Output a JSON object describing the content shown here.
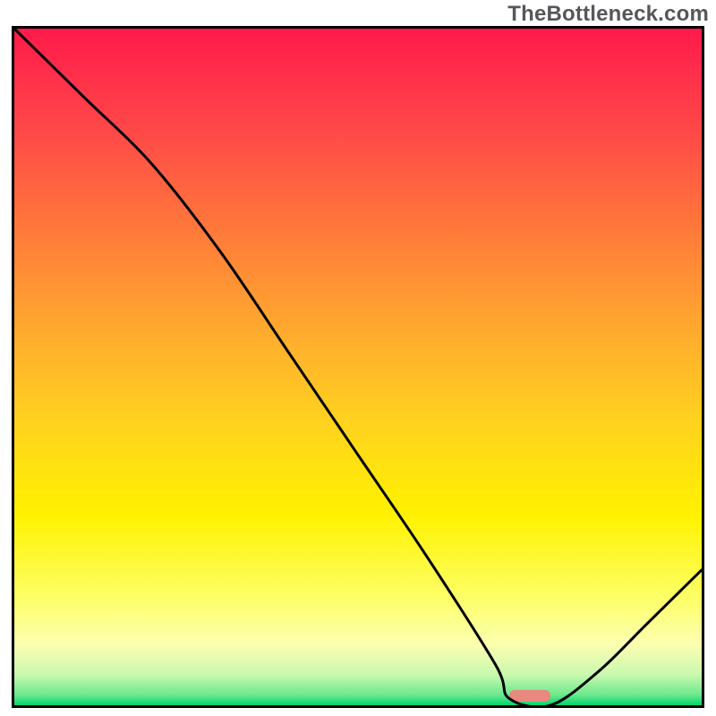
{
  "watermark": "TheBottleneck.com",
  "chart_data": {
    "type": "line",
    "title": "",
    "xlabel": "",
    "ylabel": "",
    "xlim": [
      0,
      100
    ],
    "ylim": [
      0,
      100
    ],
    "x": [
      0,
      10,
      20,
      30,
      40,
      50,
      60,
      70,
      72,
      78,
      85,
      92,
      100
    ],
    "values": [
      100,
      90,
      80,
      67,
      52,
      37,
      22,
      6,
      1,
      0,
      5,
      12,
      20
    ],
    "marker": {
      "x": 75,
      "width": 6,
      "y": 1,
      "color": "#e8887f"
    },
    "gradient_stops": [
      {
        "offset": 0.0,
        "color": "#ff1a4b"
      },
      {
        "offset": 0.15,
        "color": "#ff4848"
      },
      {
        "offset": 0.3,
        "color": "#ff7a3a"
      },
      {
        "offset": 0.45,
        "color": "#ffab2e"
      },
      {
        "offset": 0.58,
        "color": "#ffd21f"
      },
      {
        "offset": 0.72,
        "color": "#fff200"
      },
      {
        "offset": 0.84,
        "color": "#fdff66"
      },
      {
        "offset": 0.91,
        "color": "#fcffb0"
      },
      {
        "offset": 0.955,
        "color": "#c9f9af"
      },
      {
        "offset": 0.985,
        "color": "#6be88d"
      },
      {
        "offset": 1.0,
        "color": "#00d66b"
      }
    ]
  }
}
